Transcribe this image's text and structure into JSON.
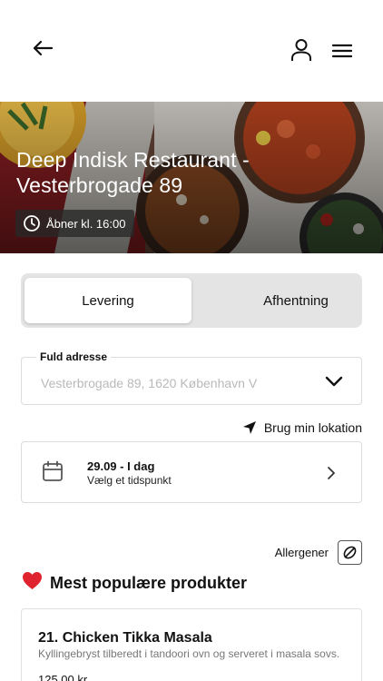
{
  "topbar": {
    "back_icon": "arrow-left-icon",
    "user_icon": "user-icon",
    "menu_icon": "hamburger-menu-icon"
  },
  "hero": {
    "title": "Deep Indisk Restaurant - Vesterbrogade 89",
    "hours": "Åbner kl. 16:00",
    "hours_icon": "clock-icon"
  },
  "delivery_toggle": {
    "options": [
      {
        "label": "Levering",
        "active": true
      },
      {
        "label": "Afhentning",
        "active": false
      }
    ]
  },
  "address": {
    "label": "Fuld adresse",
    "placeholder": "Vesterbrogade 89, 1620 København V"
  },
  "location": {
    "label": "Brug min lokation",
    "icon": "location-arrow-icon"
  },
  "date_picker": {
    "date": "29.09 - I dag",
    "subtitle": "Vælg et tidspunkt",
    "icon": "calendar-icon"
  },
  "allergens": {
    "label": "Allergener",
    "icon": "allergen-icon"
  },
  "popular": {
    "emoji": "❤️",
    "title": "Mest populære produkter"
  },
  "products": [
    {
      "name": "21. Chicken Tikka Masala",
      "description": "Kyllingebryst tilberedt i tandoori ovn og serveret i masala sovs.",
      "price": "125,00 kr."
    }
  ],
  "colors": {
    "text": "#111111",
    "muted": "#b9b9b9",
    "border": "#dcdcdc",
    "segment_bg": "#e4e4e4",
    "heart": "#e0242f"
  }
}
